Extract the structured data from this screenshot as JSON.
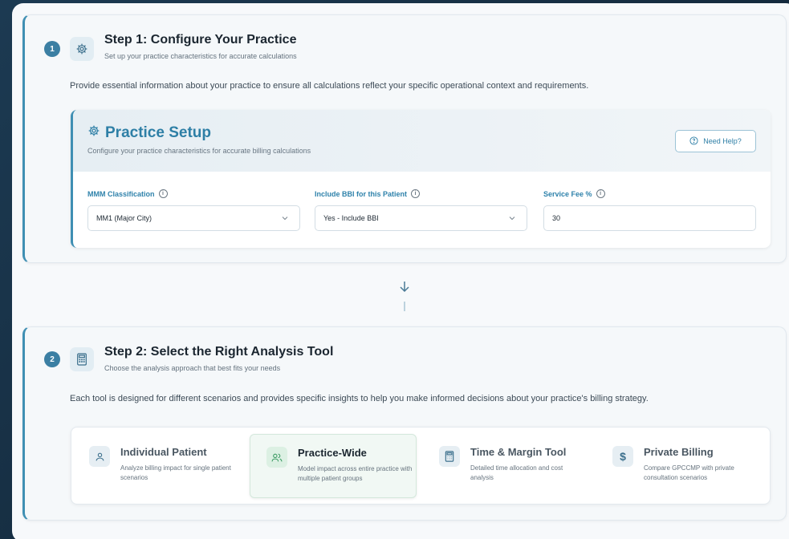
{
  "step1": {
    "number": "1",
    "title": "Step 1: Configure Your Practice",
    "subtitle": "Set up your practice characteristics for accurate calculations",
    "description": "Provide essential information about your practice to ensure all calculations reflect your specific operational context and requirements.",
    "icon": "gear-icon"
  },
  "setup": {
    "title": "Practice Setup",
    "subtitle": "Configure your practice characteristics for accurate billing calculations",
    "help_label": "Need Help?",
    "fields": {
      "mmm": {
        "label": "MMM Classification",
        "value": "MM1 (Major City)"
      },
      "bbi": {
        "label": "Include BBI for this Patient",
        "value": "Yes - Include BBI"
      },
      "fee": {
        "label": "Service Fee %",
        "value": "30"
      }
    }
  },
  "step2": {
    "number": "2",
    "title": "Step 2: Select the Right Analysis Tool",
    "subtitle": "Choose the analysis approach that best fits your needs",
    "description": "Each tool is designed for different scenarios and provides specific insights to help you make informed decisions about your practice's billing strategy.",
    "icon": "calculator-icon"
  },
  "tools": [
    {
      "title": "Individual Patient",
      "desc": "Analyze billing impact for single patient scenarios",
      "icon": "user-icon",
      "active": false
    },
    {
      "title": "Practice-Wide",
      "desc": "Model impact across entire practice with multiple patient groups",
      "icon": "users-icon",
      "active": true
    },
    {
      "title": "Time & Margin Tool",
      "desc": "Detailed time allocation and cost analysis",
      "icon": "calculator-icon",
      "active": false
    },
    {
      "title": "Private Billing",
      "desc": "Compare GPCCMP with private consultation scenarios",
      "icon": "dollar-icon",
      "active": false
    }
  ],
  "colors": {
    "accent": "#3f8fb3",
    "step_badge": "#3b7fa3",
    "active_tool_bg": "#f1f8f4"
  }
}
